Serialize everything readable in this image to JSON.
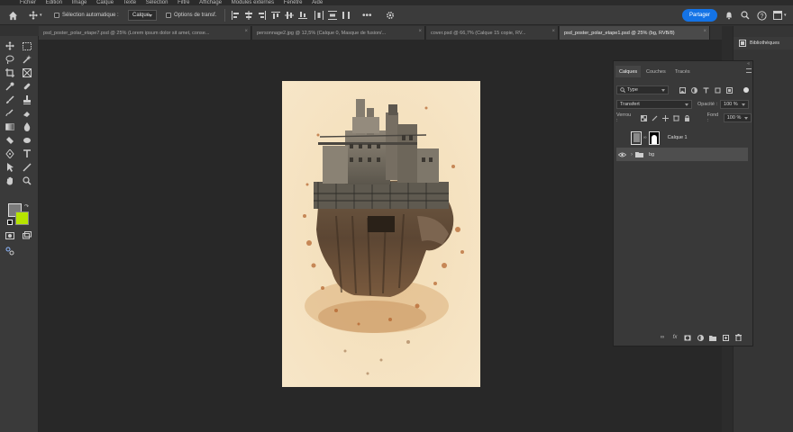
{
  "menubar": {
    "items": [
      "Fichier",
      "Edition",
      "Image",
      "Calque",
      "Texte",
      "Sélection",
      "Filtre",
      "Affichage",
      "Modules externes",
      "Fenêtre",
      "Aide"
    ]
  },
  "options_bar": {
    "auto_select_label": "Sélection automatique :",
    "auto_select_target": "Calque",
    "transform_label": "Options de transf.",
    "share_label": "Partager"
  },
  "tabs": [
    {
      "label": "psd_poster_polar_etape7.psd @ 25% (Lorem ipsum dolor sit amet, conse...",
      "active": false
    },
    {
      "label": "personnage2.jpg @ 12,5% (Calque 0, Masque de fusion/...",
      "active": false
    },
    {
      "label": "cover.psd @ 66,7% (Calque 15 copie, RV...",
      "active": false
    },
    {
      "label": "psd_poster_polar_etape1.psd @ 25% (bg, RVB/8)",
      "active": true
    }
  ],
  "tab_close_glyph": "×",
  "libraries_label": "Bibliothèques",
  "layers_panel": {
    "tabs": [
      "Calques",
      "Couches",
      "Tracés"
    ],
    "active_tab": "Calques",
    "filter_kind": "Type",
    "blend_mode": "Transfert",
    "opacity_label": "Opacité :",
    "opacity_value": "100 %",
    "lock_label": "Verrou :",
    "fill_label": "Fond :",
    "fill_value": "100 %",
    "layers": [
      {
        "name": "Calque 1",
        "visible": false,
        "selected": false,
        "type": "layer-with-mask"
      },
      {
        "name": "bg",
        "visible": true,
        "selected": true,
        "type": "group"
      }
    ],
    "footer_fx": "fx"
  },
  "colors": {
    "accent": "#1473e6",
    "foreground_swatch": "#7a7a7a",
    "background_swatch": "#b6e400",
    "canvas_bg": "#f4e0be"
  }
}
